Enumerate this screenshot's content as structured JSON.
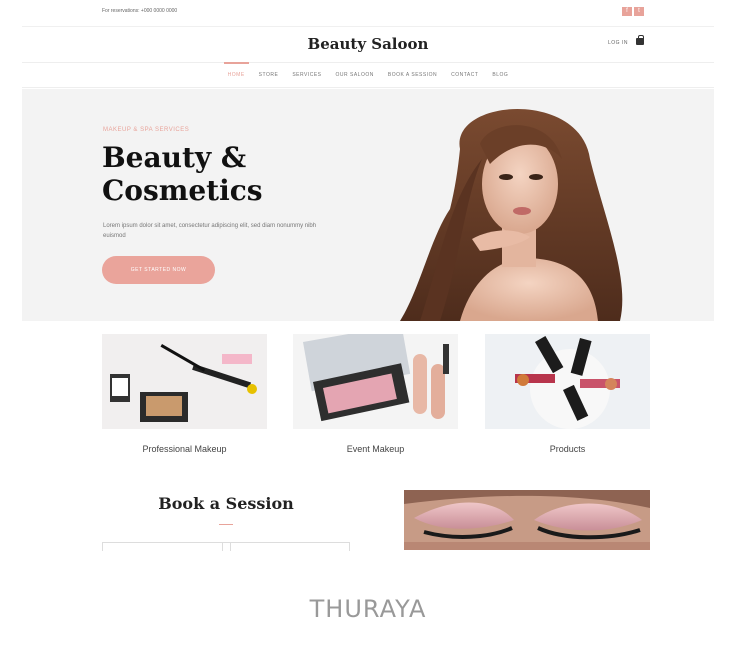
{
  "topbar": {
    "reservations": "For reservations: +000 0000 0000",
    "social": [
      "f",
      "t"
    ]
  },
  "header": {
    "brand": "Beauty Saloon",
    "login": "LOG IN",
    "cart_icon": "shopping-bag-icon"
  },
  "nav": {
    "items": [
      "HOME",
      "STORE",
      "SERVICES",
      "OUR SALOON",
      "BOOK A SESSION",
      "CONTACT",
      "BLOG"
    ],
    "active": "HOME"
  },
  "hero": {
    "kicker": "MAKEUP & SPA SERVICES",
    "title_line1": "Beauty &",
    "title_line2": "Cosmetics",
    "text": "Lorem ipsum dolor sit amet, consectetur adipiscing elit, sed diam nonummy nibh euismod",
    "cta": "GET STARTED NOW"
  },
  "services": [
    {
      "caption": "Professional Makeup"
    },
    {
      "caption": "Event Makeup"
    },
    {
      "caption": "Products"
    }
  ],
  "book": {
    "title": "Book a Session"
  },
  "footer": {
    "watermark": "THURAYA"
  },
  "colors": {
    "accent": "#e8a39a",
    "hero_bg": "#f3f3f3",
    "title": "#111111"
  }
}
